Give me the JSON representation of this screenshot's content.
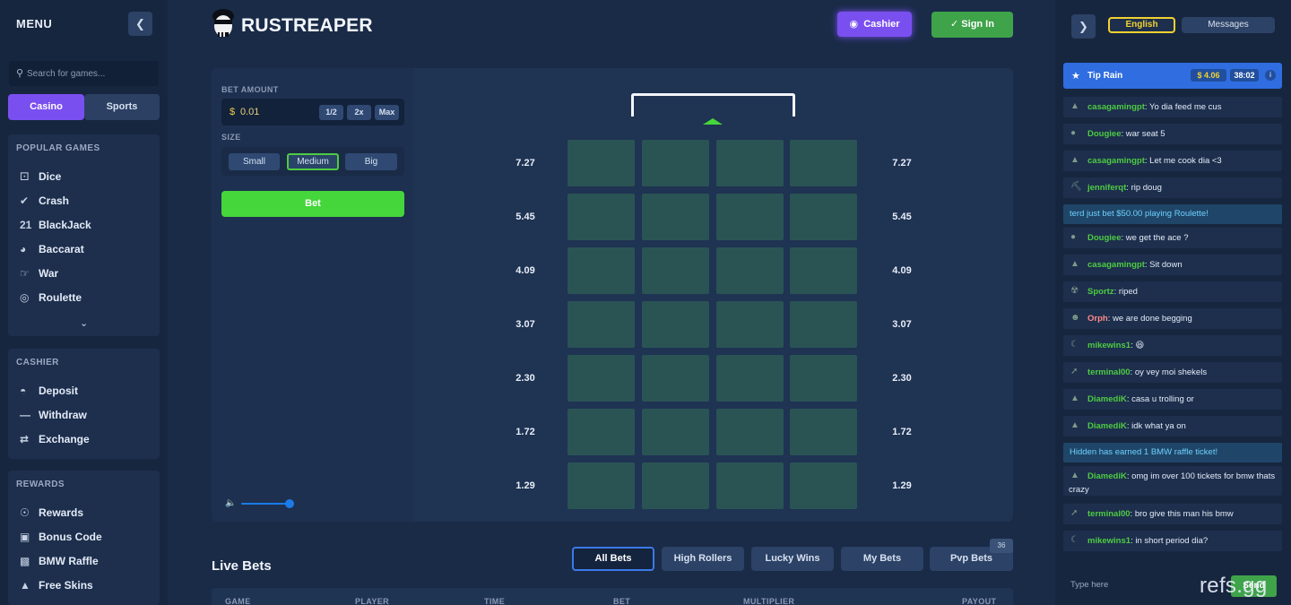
{
  "sidebar": {
    "menu_title": "MENU",
    "search_placeholder": "Search for games...",
    "seg_casino": "Casino",
    "seg_sports": "Sports",
    "popular_title": "POPULAR GAMES",
    "popular": [
      {
        "label": "Dice",
        "icon": "dice-icon"
      },
      {
        "label": "Crash",
        "icon": "rocket-icon"
      },
      {
        "label": "BlackJack",
        "icon": "cards-icon"
      },
      {
        "label": "Baccarat",
        "icon": "bowl-icon"
      },
      {
        "label": "War",
        "icon": "handshake-icon"
      },
      {
        "label": "Roulette",
        "icon": "roulette-icon"
      }
    ],
    "cashier_title": "CASHIER",
    "cashier": [
      {
        "label": "Deposit",
        "icon": "money-bag-icon"
      },
      {
        "label": "Withdraw",
        "icon": "minus-icon"
      },
      {
        "label": "Exchange",
        "icon": "exchange-icon"
      }
    ],
    "rewards_title": "REWARDS",
    "rewards": [
      {
        "label": "Rewards",
        "icon": "medal-icon"
      },
      {
        "label": "Bonus Code",
        "icon": "gift-icon"
      },
      {
        "label": "BMW Raffle",
        "icon": "car-icon"
      },
      {
        "label": "Free Skins",
        "icon": "skins-icon"
      }
    ]
  },
  "header": {
    "logo": "RUSTREAPER",
    "cashier": "Cashier",
    "signin": "Sign In"
  },
  "controls": {
    "bet_amount_label": "BET AMOUNT",
    "currency": "$",
    "amount": "0.01",
    "half": "1/2",
    "double": "2x",
    "max": "Max",
    "size_label": "SIZE",
    "sizes": [
      "Small",
      "Medium",
      "Big"
    ],
    "active_size": "Medium",
    "bet": "Bet",
    "volume_level": 0.9
  },
  "board": {
    "multipliers": [
      "7.27",
      "5.45",
      "4.09",
      "3.07",
      "2.30",
      "1.72",
      "1.29"
    ],
    "columns": 4,
    "tile_color": "#2a5454"
  },
  "live_bets": {
    "title": "Live Bets",
    "tabs": [
      "All Bets",
      "High Rollers",
      "Lucky Wins",
      "My Bets",
      "Pvp Bets"
    ],
    "active_tab": "All Bets",
    "pvp_count": "36",
    "columns": [
      "GAME",
      "PLAYER",
      "TIME",
      "BET",
      "MULTIPLIER",
      "PAYOUT"
    ]
  },
  "chat": {
    "language": "English",
    "messages_tab": "Messages",
    "tip_rain": {
      "label": "Tip Rain",
      "amount": "$ 4.06",
      "time": "38:02"
    },
    "items": [
      {
        "type": "msg",
        "user": "casagamingpt",
        "text": "Yo dia feed me cus",
        "color": "#4ecb42",
        "avatar": "hat-icon"
      },
      {
        "type": "msg",
        "user": "Dougiee",
        "text": "war seat 5",
        "color": "#4ecb42",
        "avatar": "glasses-icon"
      },
      {
        "type": "msg",
        "user": "casagamingpt",
        "text": "Let me cook dia <3",
        "color": "#4ecb42",
        "avatar": "hat-icon"
      },
      {
        "type": "msg",
        "user": "jenniferqt",
        "text": "rip doug",
        "color": "#4ecb42",
        "avatar": "pickaxe-icon"
      },
      {
        "type": "sys",
        "text": "terd just bet $50.00 playing Roulette!"
      },
      {
        "type": "msg",
        "user": "Dougiee",
        "text": "we get the ace ?",
        "color": "#4ecb42",
        "avatar": "glasses-icon"
      },
      {
        "type": "msg",
        "user": "casagamingpt",
        "text": "Sit down",
        "color": "#4ecb42",
        "avatar": "hat-icon"
      },
      {
        "type": "msg",
        "user": "Sportz",
        "text": "riped",
        "color": "#4ecb42",
        "avatar": "radiation-icon"
      },
      {
        "type": "msg",
        "user": "Orph",
        "text": "we are done begging",
        "color": "#ff8a8a",
        "avatar": "face-icon"
      },
      {
        "type": "msg",
        "user": "mikewins1",
        "text": "😆",
        "color": "#4ecb42",
        "avatar": "banana-icon"
      },
      {
        "type": "msg",
        "user": "terminal00",
        "text": "oy vey moi shekels",
        "color": "#4ecb42",
        "avatar": "knife-icon"
      },
      {
        "type": "msg",
        "user": "DiamediK",
        "text": "casa u trolling or",
        "color": "#4ecb42",
        "avatar": "hat-icon"
      },
      {
        "type": "msg",
        "user": "DiamediK",
        "text": "idk what ya on",
        "color": "#4ecb42",
        "avatar": "hat-icon"
      },
      {
        "type": "sys",
        "text": "Hidden has earned 1 BMW raffle ticket!"
      },
      {
        "type": "msg2",
        "user": "DiamediK",
        "text": "omg im over 100 tickets for bmw thats crazy",
        "color": "#4ecb42",
        "avatar": "hat-icon"
      },
      {
        "type": "msg",
        "user": "terminal00",
        "text": "bro give this man his bmw",
        "color": "#4ecb42",
        "avatar": "knife-icon"
      },
      {
        "type": "msg",
        "user": "mikewins1",
        "text": "in short period dia?",
        "color": "#4ecb42",
        "avatar": "banana-icon"
      }
    ],
    "input_placeholder": "Type here",
    "send": "Send"
  },
  "watermark": "refs.gg"
}
